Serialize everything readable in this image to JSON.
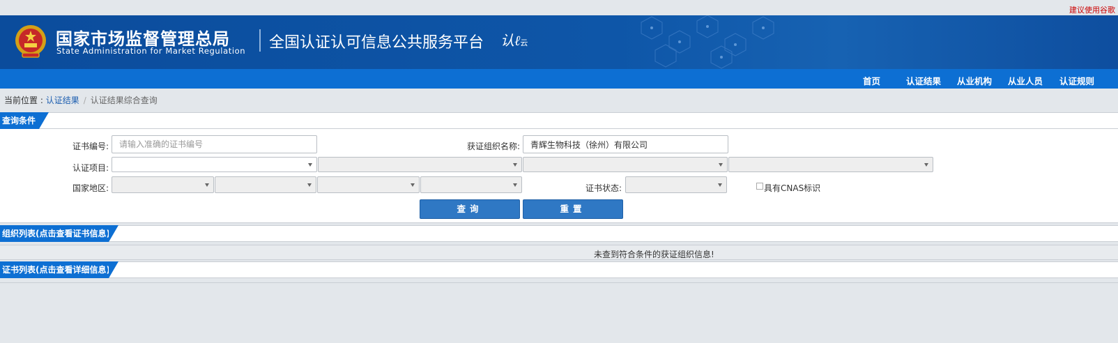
{
  "top_note": "建议使用谷歌",
  "header": {
    "brand_cn": "国家市场监督管理总局",
    "brand_en": "State Administration  for  Market Regulation",
    "platform_title": "全国认证认可信息公共服务平台",
    "logo_text": "认",
    "logo_sub": "云",
    "colors": {
      "banner": "#0b4c9c",
      "nav": "#0d6fd3",
      "accent_link": "#1e5fb0",
      "note_red": "#cc0000"
    }
  },
  "nav": {
    "items": [
      {
        "label": "首页"
      },
      {
        "label": "认证结果"
      },
      {
        "label": "从业机构"
      },
      {
        "label": "从业人员"
      },
      {
        "label": "认证规则"
      }
    ]
  },
  "breadcrumb": {
    "prefix": "当前位置 : ",
    "parent": "认证结果",
    "separator": "/",
    "current": "认证结果综合查询"
  },
  "query": {
    "section_title": "查询条件",
    "cert_no": {
      "label": "证书编号:",
      "placeholder": "请输入准确的证书编号",
      "value": ""
    },
    "org_name": {
      "label": "获证组织名称:",
      "value": "青辉生物科技（徐州）有限公司"
    },
    "cert_project": {
      "label": "认证项目:",
      "selected": [
        "",
        "",
        "",
        ""
      ]
    },
    "region": {
      "label": "国家地区:",
      "selected": [
        "",
        "",
        "",
        ""
      ]
    },
    "cert_status": {
      "label": "证书状态:",
      "selected": ""
    },
    "cnas": {
      "label": "具有CNAS标识",
      "checked": false
    },
    "search_button": "查询",
    "reset_button": "重置"
  },
  "org_list": {
    "section_title": "组织列表(点击查看证书信息)",
    "empty_message": "未查到符合条件的获证组织信息!"
  },
  "cert_list": {
    "section_title": "证书列表(点击查看详细信息)"
  }
}
